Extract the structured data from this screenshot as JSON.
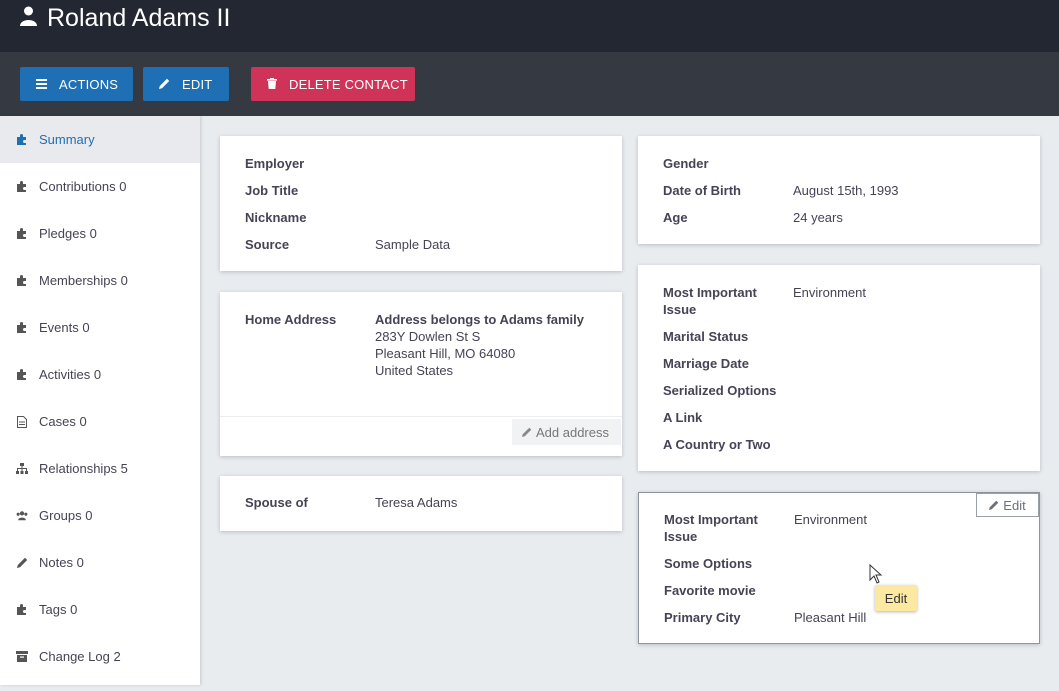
{
  "header": {
    "title": "Roland Adams II",
    "icon": "user-icon"
  },
  "toolbar": {
    "actions_label": "ACTIONS",
    "edit_label": "EDIT",
    "delete_label": "DELETE CONTACT"
  },
  "sidebar": {
    "items": [
      {
        "label": "Summary",
        "icon": "puzzle-icon"
      },
      {
        "label": "Contributions 0",
        "icon": "puzzle-icon"
      },
      {
        "label": "Pledges 0",
        "icon": "puzzle-icon"
      },
      {
        "label": "Memberships 0",
        "icon": "puzzle-icon"
      },
      {
        "label": "Events 0",
        "icon": "puzzle-icon"
      },
      {
        "label": "Activities 0",
        "icon": "puzzle-icon"
      },
      {
        "label": "Cases 0",
        "icon": "file-icon"
      },
      {
        "label": "Relationships 5",
        "icon": "sitemap-icon"
      },
      {
        "label": "Groups 0",
        "icon": "users-icon"
      },
      {
        "label": "Notes 0",
        "icon": "pencil-icon"
      },
      {
        "label": "Tags 0",
        "icon": "puzzle-icon"
      },
      {
        "label": "Change Log 2",
        "icon": "archive-icon"
      }
    ]
  },
  "employment": {
    "employer_label": "Employer",
    "job_title_label": "Job Title",
    "nickname_label": "Nickname",
    "source_label": "Source",
    "source_value": "Sample Data"
  },
  "address": {
    "label": "Home Address",
    "belongs": "Address belongs to Adams family",
    "street": "283Y Dowlen St S",
    "city": "Pleasant Hill, MO 64080",
    "country": "United States",
    "add_address_label": "Add address"
  },
  "relationship": {
    "label": "Spouse of",
    "value": "Teresa Adams"
  },
  "demographics": {
    "gender_label": "Gender",
    "dob_label": "Date of Birth",
    "dob_value": "August 15th, 1993",
    "age_label": "Age",
    "age_value": "24 years"
  },
  "custom1": {
    "issue_label": "Most Important Issue",
    "issue_value": "Environment",
    "marital_label": "Marital Status",
    "marriage_label": "Marriage Date",
    "serialized_label": "Serialized Options",
    "link_label": "A Link",
    "country_label": "A Country or Two"
  },
  "custom2": {
    "edit_label": "Edit",
    "issue_label": "Most Important Issue",
    "issue_value": "Environment",
    "options_label": "Some Options",
    "movie_label": "Favorite movie",
    "city_label": "Primary City",
    "city_value": "Pleasant Hill"
  },
  "tooltip": {
    "text": "Edit"
  },
  "colors": {
    "header_bg": "#222731",
    "toolbar_bg": "#353942",
    "primary": "#1f6fb4",
    "danger": "#cf3458",
    "tooltip_bg": "#fbe8a1"
  }
}
